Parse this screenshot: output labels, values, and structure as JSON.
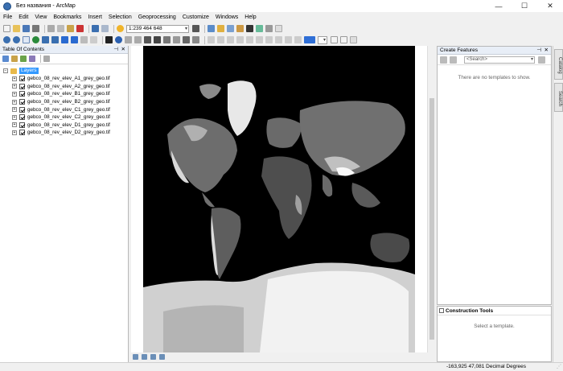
{
  "window": {
    "title": "Без названия - ArcMap",
    "minimize": "—",
    "maximize": "☐",
    "close": "✕"
  },
  "menu": [
    "File",
    "Edit",
    "View",
    "Bookmarks",
    "Insert",
    "Selection",
    "Geoprocessing",
    "Customize",
    "Windows",
    "Help"
  ],
  "toolbar": {
    "scale_value": "1:239 464 648"
  },
  "toc": {
    "title": "Table Of Contents",
    "root_label": "Layers",
    "layers": [
      "gebco_08_rev_elev_A1_grey_geo.tif",
      "gebco_08_rev_elev_A2_grey_geo.tif",
      "gebco_08_rev_elev_B1_grey_geo.tif",
      "gebco_08_rev_elev_B2_grey_geo.tif",
      "gebco_08_rev_elev_C1_grey_geo.tif",
      "gebco_08_rev_elev_C2_grey_geo.tif",
      "gebco_08_rev_elev_D1_grey_geo.tif",
      "gebco_08_rev_elev_D2_grey_geo.tif"
    ]
  },
  "create_features": {
    "title": "Create Features",
    "search_placeholder": "<Search>",
    "empty_message": "There are no templates to show."
  },
  "construction_tools": {
    "title": "Construction Tools",
    "message": "Select a template."
  },
  "side_tabs": [
    "Catalog",
    "Search"
  ],
  "status": {
    "coordinates": "-163,925  47,081 Decimal Degrees"
  },
  "colors": {
    "accent": "#3399ff",
    "map_background": "#000000"
  }
}
